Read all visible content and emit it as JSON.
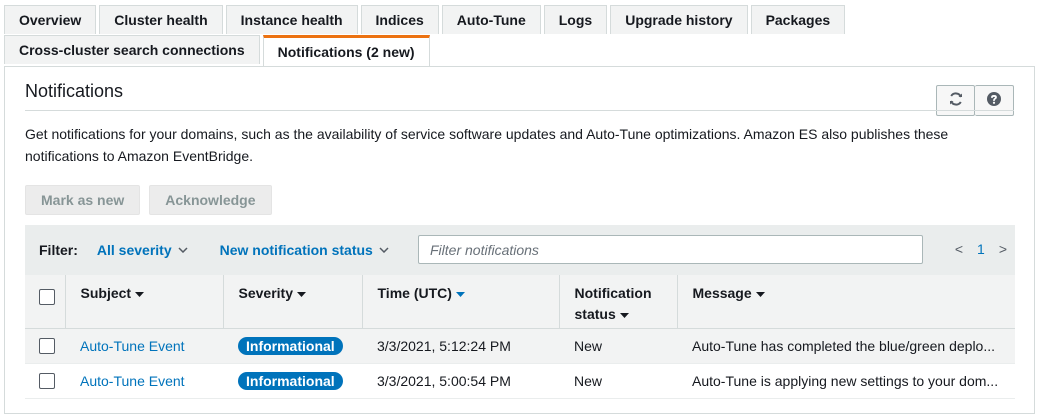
{
  "tabs": {
    "row1": [
      "Overview",
      "Cluster health",
      "Instance health",
      "Indices",
      "Auto-Tune",
      "Logs",
      "Upgrade history",
      "Packages"
    ],
    "row2": [
      "Cross-cluster search connections",
      "Notifications (2 new)"
    ],
    "active": "Notifications (2 new)"
  },
  "panel": {
    "title": "Notifications",
    "refresh_icon": "refresh-icon",
    "help_icon": "help-icon",
    "description": "Get notifications for your domains, such as the availability of service software updates and Auto-Tune optimizations. Amazon ES also publishes these notifications to Amazon EventBridge."
  },
  "actions": {
    "mark_as_new": "Mark as new",
    "acknowledge": "Acknowledge"
  },
  "filter": {
    "label": "Filter:",
    "severity": "All severity",
    "status": "New notification status",
    "placeholder": "Filter notifications",
    "page": "1",
    "prev": "<",
    "next": ">"
  },
  "table": {
    "columns": {
      "subject": "Subject",
      "severity": "Severity",
      "time": "Time (UTC)",
      "status_line1": "Notification",
      "status_line2": "status",
      "message": "Message"
    },
    "rows": [
      {
        "subject": "Auto-Tune Event",
        "severity": "Informational",
        "time": "3/3/2021, 5:12:24 PM",
        "status": "New",
        "message": "Auto-Tune has completed the blue/green deplo..."
      },
      {
        "subject": "Auto-Tune Event",
        "severity": "Informational",
        "time": "3/3/2021, 5:00:54 PM",
        "status": "New",
        "message": "Auto-Tune is applying new settings to your dom..."
      }
    ]
  },
  "colors": {
    "accent": "#ec7211",
    "link": "#0073bb",
    "badge": "#0073bb"
  }
}
